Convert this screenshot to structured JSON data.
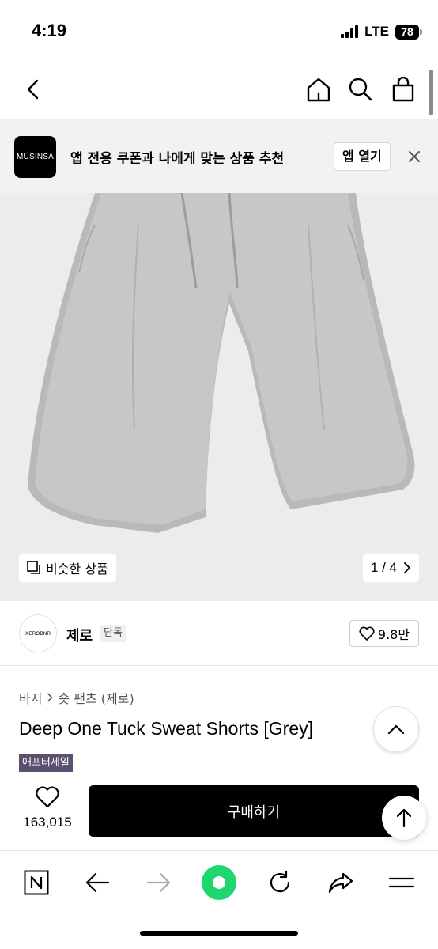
{
  "status_bar": {
    "time": "4:19",
    "network": "LTE",
    "battery": "78"
  },
  "banner": {
    "logo_text": "MUSINSA",
    "message": "앱 전용 쿠폰과 나에게 맞는 상품 추천",
    "open_label": "앱 열기"
  },
  "gallery": {
    "similar_label": "비슷한 상품",
    "pager": "1 / 4"
  },
  "brand": {
    "logo_text": "XEROBNR",
    "name": "제로",
    "badge": "단독",
    "likes": "9.8만"
  },
  "product": {
    "breadcrumb": [
      "바지",
      "숏 팬츠 (제로)"
    ],
    "title": "Deep One Tuck Sweat Shorts [Grey]",
    "sale_tag": "애프터세일"
  },
  "purchase": {
    "wish_count": "163,015",
    "buy_label": "구매하기"
  },
  "colors": {
    "accent_green": "#20d66e",
    "sale_tag_bg": "#5c5070",
    "buy_button": "#000000"
  }
}
